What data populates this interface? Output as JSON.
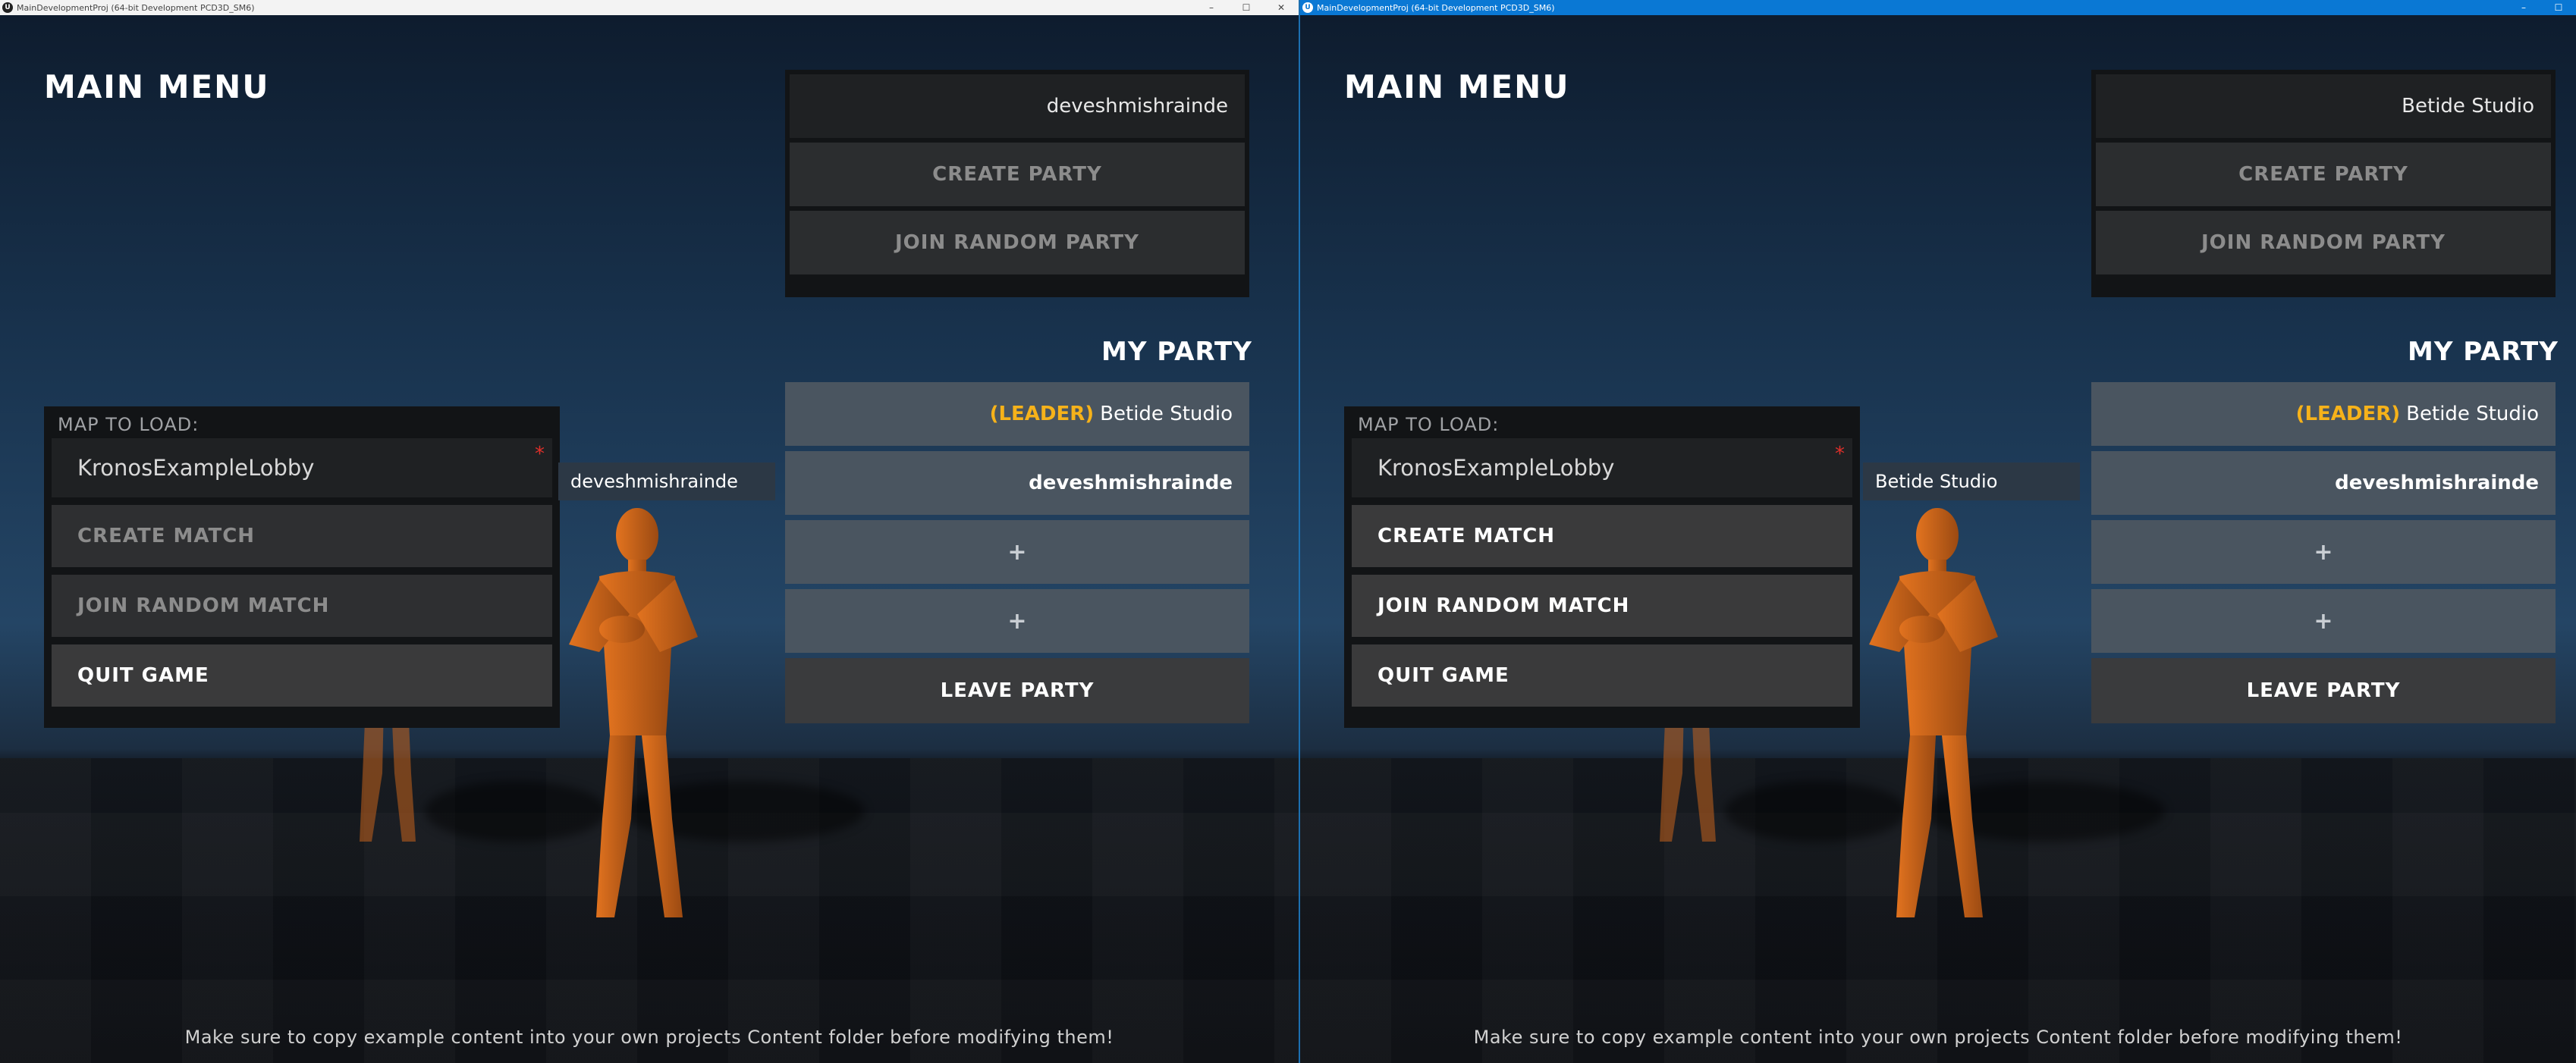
{
  "left": {
    "window_title": "MainDevelopmentProj (64-bit Development PCD3D_SM6)",
    "main_title": "MAIN MENU",
    "account_name": "deveshmishrainde",
    "create_party": "CREATE PARTY",
    "join_random_party": "JOIN RANDOM PARTY",
    "party_title": "MY PARTY",
    "party_members": [
      {
        "leader_tag": "(LEADER)",
        "name": "Betide Studio"
      },
      {
        "leader_tag": "",
        "name": "deveshmishrainde"
      }
    ],
    "empty_slot": "+",
    "leave_party": "LEAVE PARTY",
    "map_label": "MAP TO LOAD:",
    "map_value": "KronosExampleLobby",
    "required_marker": "*",
    "create_match": "CREATE MATCH",
    "join_random_match": "JOIN RANDOM MATCH",
    "quit_game": "QUIT GAME",
    "nameplate": "deveshmishrainde",
    "hint": "Make sure to copy example content into your own projects Content folder before modifying them!"
  },
  "right": {
    "window_title": "MainDevelopmentProj (64-bit Development PCD3D_SM6)",
    "main_title": "MAIN MENU",
    "account_name": "Betide Studio",
    "create_party": "CREATE PARTY",
    "join_random_party": "JOIN RANDOM PARTY",
    "party_title": "MY PARTY",
    "party_members": [
      {
        "leader_tag": "(LEADER)",
        "name": "Betide Studio"
      },
      {
        "leader_tag": "",
        "name": "deveshmishrainde"
      }
    ],
    "empty_slot": "+",
    "leave_party": "LEAVE PARTY",
    "map_label": "MAP TO LOAD:",
    "map_value": "KronosExampleLobby",
    "required_marker": "*",
    "create_match": "CREATE MATCH",
    "join_random_match": "JOIN RANDOM MATCH",
    "quit_game": "QUIT GAME",
    "nameplate": "Betide Studio",
    "hint": "Make sure to copy example content into your own projects Content folder before modifying them!"
  },
  "window_controls": {
    "minimize": "–",
    "maximize": "☐",
    "close": "✕"
  },
  "icons": {
    "app": "unreal-engine-logo-icon"
  },
  "colors": {
    "leader_tag": "#f6b21a",
    "required": "#e0302a",
    "active_titlebar": "#0a78d4"
  }
}
